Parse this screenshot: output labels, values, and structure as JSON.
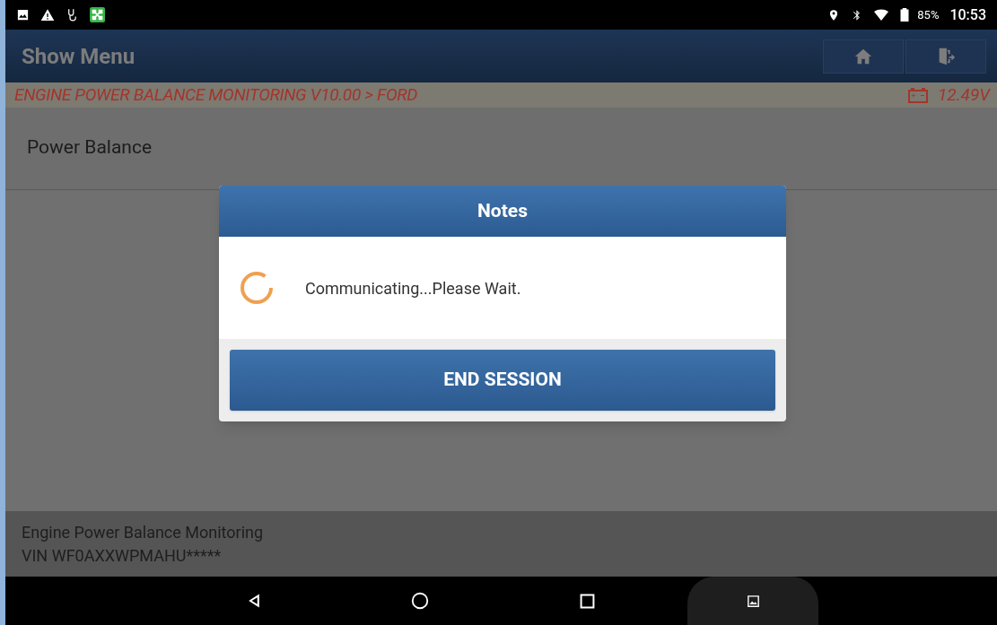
{
  "status_bar": {
    "battery": "85%",
    "time": "10:53"
  },
  "header": {
    "title": "Show Menu"
  },
  "breadcrumb": {
    "path": "ENGINE POWER BALANCE MONITORING V10.00 > FORD",
    "voltage": "12.49V"
  },
  "page_title": "Power Balance",
  "dialog": {
    "title": "Notes",
    "message": "Communicating...Please Wait.",
    "button": "END SESSION"
  },
  "footer": {
    "lines": [
      "Engine Power Balance Monitoring",
      "VIN WF0AXXWPMAHU*****"
    ]
  }
}
